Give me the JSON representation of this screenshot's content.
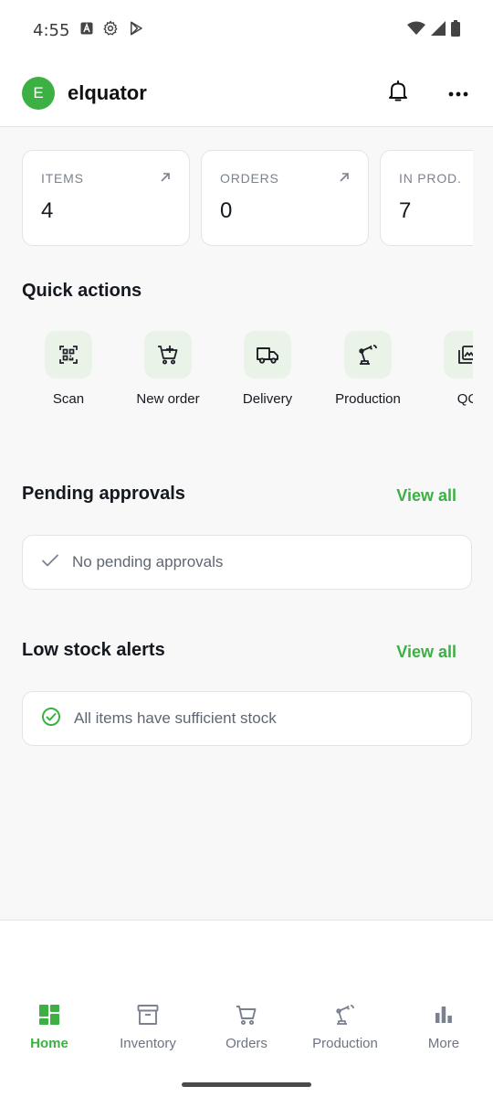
{
  "status": {
    "time": "4:55"
  },
  "header": {
    "avatar_letter": "E",
    "title": "elquator"
  },
  "stats": [
    {
      "label": "ITEMS",
      "value": "4"
    },
    {
      "label": "ORDERS",
      "value": "0"
    },
    {
      "label": "IN PROD.",
      "value": "7"
    }
  ],
  "quick_actions": {
    "title": "Quick actions",
    "items": [
      {
        "label": "Scan",
        "icon": "qr-scan-icon"
      },
      {
        "label": "New order",
        "icon": "cart-add-icon"
      },
      {
        "label": "Delivery",
        "icon": "truck-icon"
      },
      {
        "label": "Production",
        "icon": "robot-arm-icon"
      },
      {
        "label": "QC",
        "icon": "gallery-icon"
      }
    ]
  },
  "pending": {
    "title": "Pending approvals",
    "view_all": "View all",
    "empty_text": "No pending approvals"
  },
  "low_stock": {
    "title": "Low stock alerts",
    "view_all": "View all",
    "empty_text": "All items have sufficient stock"
  },
  "nav": [
    {
      "label": "Home",
      "icon": "dashboard-icon",
      "active": true
    },
    {
      "label": "Inventory",
      "icon": "archive-box-icon",
      "active": false
    },
    {
      "label": "Orders",
      "icon": "cart-icon",
      "active": false
    },
    {
      "label": "Production",
      "icon": "robot-arm-icon",
      "active": false
    },
    {
      "label": "More",
      "icon": "bar-chart-icon",
      "active": false
    }
  ],
  "colors": {
    "accent": "#3cb043",
    "accent_soft": "#e9f3e8",
    "text": "#14181f",
    "muted": "#7a8290"
  }
}
